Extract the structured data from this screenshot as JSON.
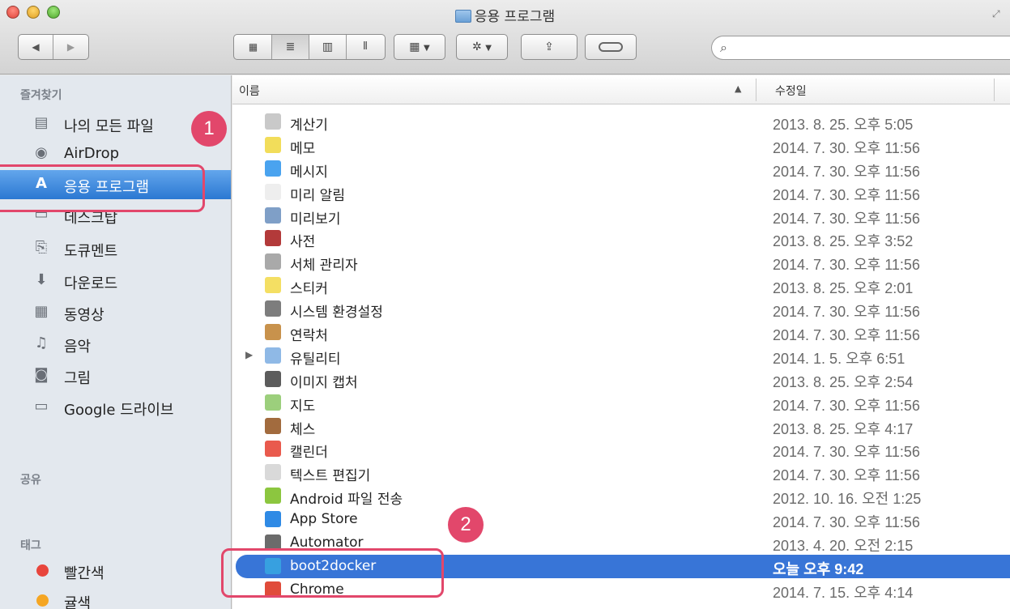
{
  "window": {
    "title": "응용 프로그램"
  },
  "toolbar": {
    "view_icons": [
      "grid-view-icon",
      "list-view-icon",
      "column-view-icon",
      "coverflow-view-icon"
    ],
    "arrange_label": "",
    "search_placeholder": ""
  },
  "sidebar": {
    "favorites_header": "즐겨찾기",
    "items": [
      {
        "label": "나의 모든 파일",
        "icon": "all-files-icon",
        "glyph": "▤"
      },
      {
        "label": "AirDrop",
        "icon": "airdrop-icon",
        "glyph": "◉"
      },
      {
        "label": "응용 프로그램",
        "icon": "applications-icon",
        "glyph": "A"
      },
      {
        "label": "데스크탑",
        "icon": "desktop-icon",
        "glyph": "▭"
      },
      {
        "label": "도큐멘트",
        "icon": "documents-icon",
        "glyph": "⎘"
      },
      {
        "label": "다운로드",
        "icon": "downloads-icon",
        "glyph": "⬇"
      },
      {
        "label": "동영상",
        "icon": "movies-icon",
        "glyph": "▦"
      },
      {
        "label": "음악",
        "icon": "music-icon",
        "glyph": "♫"
      },
      {
        "label": "그림",
        "icon": "pictures-icon",
        "glyph": "◙"
      },
      {
        "label": "Google 드라이브",
        "icon": "folder-icon",
        "glyph": "▭"
      }
    ],
    "shared_header": "공유",
    "tags_header": "태그",
    "tags": [
      {
        "label": "빨간색",
        "color": "#e8453c"
      },
      {
        "label": "귤색",
        "color": "#f5a623"
      }
    ]
  },
  "list": {
    "col_name": "이름",
    "col_date": "수정일",
    "rows": [
      {
        "name": "계산기",
        "date": "2013. 8. 25. 오후 5:05",
        "color": "#c9c9c9"
      },
      {
        "name": "메모",
        "date": "2014. 7. 30. 오후 11:56",
        "color": "#f2dd5a"
      },
      {
        "name": "메시지",
        "date": "2014. 7. 30. 오후 11:56",
        "color": "#4aa3ef"
      },
      {
        "name": "미리 알림",
        "date": "2014. 7. 30. 오후 11:56",
        "color": "#eeeeee"
      },
      {
        "name": "미리보기",
        "date": "2014. 7. 30. 오후 11:56",
        "color": "#7f9fc7"
      },
      {
        "name": "사전",
        "date": "2013. 8. 25. 오후 3:52",
        "color": "#b33a3a"
      },
      {
        "name": "서체 관리자",
        "date": "2014. 7. 30. 오후 11:56",
        "color": "#a9a9a9"
      },
      {
        "name": "스티커",
        "date": "2013. 8. 25. 오후 2:01",
        "color": "#f4df63"
      },
      {
        "name": "시스템 환경설정",
        "date": "2014. 7. 30. 오후 11:56",
        "color": "#7d7d7d"
      },
      {
        "name": "연락처",
        "date": "2014. 7. 30. 오후 11:56",
        "color": "#c8924c"
      },
      {
        "name": "유틸리티",
        "date": "2014. 1. 5. 오후 6:51",
        "color": "#8fb9e6",
        "folder": true
      },
      {
        "name": "이미지 캡처",
        "date": "2013. 8. 25. 오후 2:54",
        "color": "#5c5c5c"
      },
      {
        "name": "지도",
        "date": "2014. 7. 30. 오후 11:56",
        "color": "#9ccf7c"
      },
      {
        "name": "체스",
        "date": "2013. 8. 25. 오후 4:17",
        "color": "#a26b3e"
      },
      {
        "name": "캘린더",
        "date": "2014. 7. 30. 오후 11:56",
        "color": "#e95a4d"
      },
      {
        "name": "텍스트 편집기",
        "date": "2014. 7. 30. 오후 11:56",
        "color": "#d9d9d9"
      },
      {
        "name": "Android 파일 전송",
        "date": "2012. 10. 16. 오전 1:25",
        "color": "#8cc63f"
      },
      {
        "name": "App Store",
        "date": "2014. 7. 30. 오후 11:56",
        "color": "#2f8ae5"
      },
      {
        "name": "Automator",
        "date": "2013. 4. 20. 오전 2:15",
        "color": "#6b6b6b"
      },
      {
        "name": "boot2docker",
        "date": "오늘 오후 9:42",
        "color": "#37a0e0",
        "selected": true
      },
      {
        "name": "Chrome",
        "date": "2014. 7. 15. 오후 4:14",
        "color": "#e04b3a"
      }
    ]
  },
  "annotations": [
    {
      "label": "1"
    },
    {
      "label": "2"
    }
  ],
  "colors": {
    "selection": "#3875d7",
    "sidebar_selection": "#2b78d2",
    "annotation": "#e2476b"
  }
}
